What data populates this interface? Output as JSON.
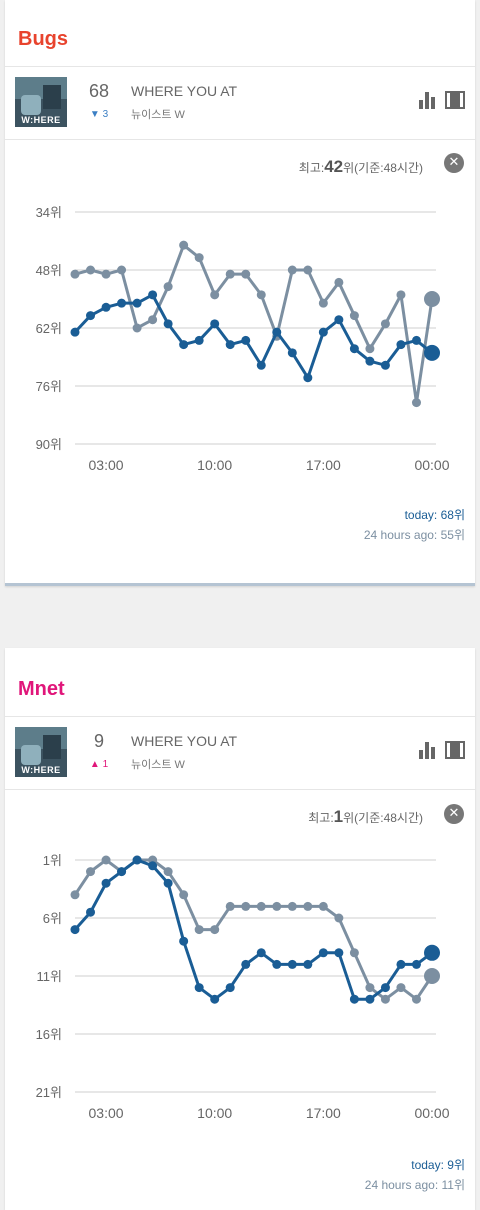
{
  "cards": [
    {
      "brand": "Bugs",
      "brand_color": "#e8432d",
      "rank": "68",
      "change_symbol": "▼",
      "change_value": "3",
      "change_color": "#3b7fc4",
      "title": "WHERE YOU AT",
      "artist": "뉴이스트 W",
      "album_text": "W:HERE",
      "best_prefix": "최고:",
      "best_value": "42",
      "best_suffix": "위(기준:48시간)",
      "today": "today: 68위",
      "ago": "24 hours ago: 55위",
      "chart_data": {
        "type": "line",
        "y_reversed": true,
        "ylim": [
          34,
          90
        ],
        "y_ticks": [
          34,
          48,
          62,
          76,
          90
        ],
        "y_tick_labels": [
          "34위",
          "48위",
          "62위",
          "76위",
          "90위"
        ],
        "x_tick_labels": [
          "03:00",
          "10:00",
          "17:00",
          "00:00"
        ],
        "x_tick_index": [
          2,
          9,
          16,
          23
        ],
        "series": [
          {
            "color": "#1a5d95",
            "values": [
              63,
              59,
              57,
              56,
              56,
              54,
              61,
              66,
              65,
              61,
              66,
              65,
              71,
              63,
              68,
              74,
              63,
              60,
              67,
              70,
              71,
              66,
              65,
              68
            ]
          },
          {
            "color": "#7c8fa1",
            "values": [
              49,
              48,
              49,
              48,
              62,
              60,
              52,
              42,
              45,
              54,
              49,
              49,
              54,
              64,
              48,
              48,
              56,
              51,
              59,
              67,
              61,
              54,
              80,
              55
            ]
          }
        ]
      }
    },
    {
      "brand": "Mnet",
      "brand_color": "#e0167a",
      "rank": "9",
      "change_symbol": "▲",
      "change_value": "1",
      "change_color": "#e0167a",
      "title": "WHERE YOU AT",
      "artist": "뉴이스트 W",
      "album_text": "W:HERE",
      "best_prefix": "최고:",
      "best_value": "1",
      "best_suffix": "위(기준:48시간)",
      "today": "today: 9위",
      "ago": "24 hours ago: 11위",
      "chart_data": {
        "type": "line",
        "y_reversed": true,
        "ylim": [
          1,
          21
        ],
        "y_ticks": [
          1,
          6,
          11,
          16,
          21
        ],
        "y_tick_labels": [
          "1위",
          "6위",
          "11위",
          "16위",
          "21위"
        ],
        "x_tick_labels": [
          "03:00",
          "10:00",
          "17:00",
          "00:00"
        ],
        "x_tick_index": [
          2,
          9,
          16,
          23
        ],
        "series": [
          {
            "color": "#1a5d95",
            "values": [
              7,
              5.5,
              3,
              2,
              1,
              1.5,
              3,
              8,
              12,
              13,
              12,
              10,
              9,
              10,
              10,
              10,
              9,
              9,
              13,
              13,
              12,
              10,
              10,
              9
            ]
          },
          {
            "color": "#7c8fa1",
            "values": [
              4,
              2,
              1,
              2,
              1,
              1,
              2,
              4,
              7,
              7,
              5,
              5,
              5,
              5,
              5,
              5,
              5,
              6,
              9,
              12,
              13,
              12,
              13,
              11
            ]
          }
        ]
      }
    }
  ]
}
